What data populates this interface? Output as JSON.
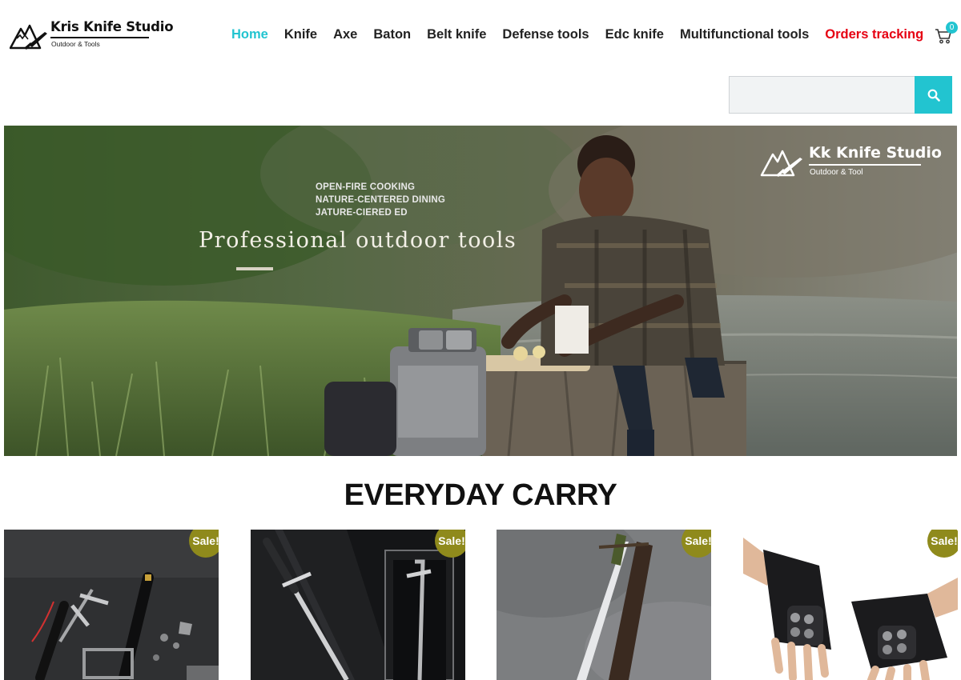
{
  "brand": {
    "name": "Kris Knife Studio",
    "tagline": "Outdoor & Tools",
    "logo_icon": "mountain-knife-logo"
  },
  "nav": {
    "items": [
      {
        "label": "Home",
        "state": "active"
      },
      {
        "label": "Knife"
      },
      {
        "label": "Axe"
      },
      {
        "label": "Baton"
      },
      {
        "label": "Belt knife"
      },
      {
        "label": "Defense tools"
      },
      {
        "label": "Edc knife"
      },
      {
        "label": "Multifunctional tools"
      },
      {
        "label": "Orders tracking",
        "state": "highlight"
      }
    ]
  },
  "cart": {
    "icon": "cart-icon",
    "count": "0"
  },
  "search": {
    "placeholder": "",
    "icon": "search-icon"
  },
  "hero": {
    "tags": [
      "OPEN-FIRE COOKING",
      "NATURE-CENTERED DINING",
      "JATURE-CIERED ED"
    ],
    "title": "Professional outdoor tools",
    "brand_name": "Kk Knife Studio",
    "brand_sub": "Outdoor & Tool"
  },
  "section": {
    "title": "EVERYDAY CARRY"
  },
  "products": [
    {
      "badge": "Sale!",
      "image": "baton-set-photo"
    },
    {
      "badge": "Sale!",
      "image": "sword-display-photo"
    },
    {
      "badge": "Sale!",
      "image": "machete-photo"
    },
    {
      "badge": "Sale!",
      "image": "tactical-gloves-photo"
    }
  ],
  "colors": {
    "accent": "#22c4d0",
    "alert": "#e60012",
    "sale_badge": "#8f8a1c",
    "text": "#222222"
  }
}
